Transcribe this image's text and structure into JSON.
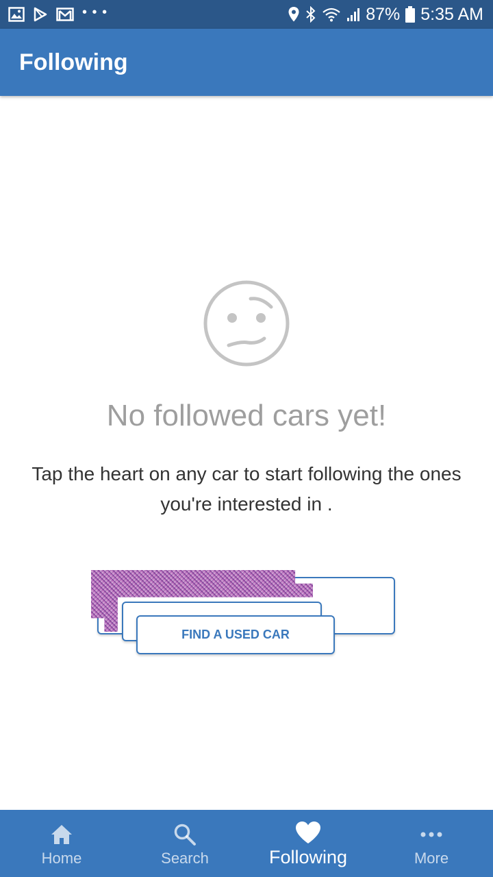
{
  "status_bar": {
    "battery": "87%",
    "time": "5:35 AM",
    "left_icons": [
      "gallery-icon",
      "play-store-icon",
      "gmail-icon",
      "more-dots-icon"
    ],
    "right_icons": [
      "location-icon",
      "bluetooth-icon",
      "wifi-icon",
      "signal-icon",
      "battery-icon"
    ]
  },
  "app_bar": {
    "title": "Following"
  },
  "empty_state": {
    "icon": "confused-face-icon",
    "title": "No followed cars yet!",
    "description": "Tap the heart on any car to start following the ones you're interested in ."
  },
  "action": {
    "button_label": "FIND A USED CAR"
  },
  "bottom_nav": {
    "items": [
      {
        "label": "Home",
        "icon": "home-icon"
      },
      {
        "label": "Search",
        "icon": "search-icon"
      },
      {
        "label": "Following",
        "icon": "heart-icon",
        "active": true
      },
      {
        "label": "More",
        "icon": "more-dots-icon"
      }
    ]
  },
  "colors": {
    "status_bar": "#2b5789",
    "primary": "#3a78bc",
    "empty_title": "#9e9e9e",
    "body_text": "#333333"
  }
}
